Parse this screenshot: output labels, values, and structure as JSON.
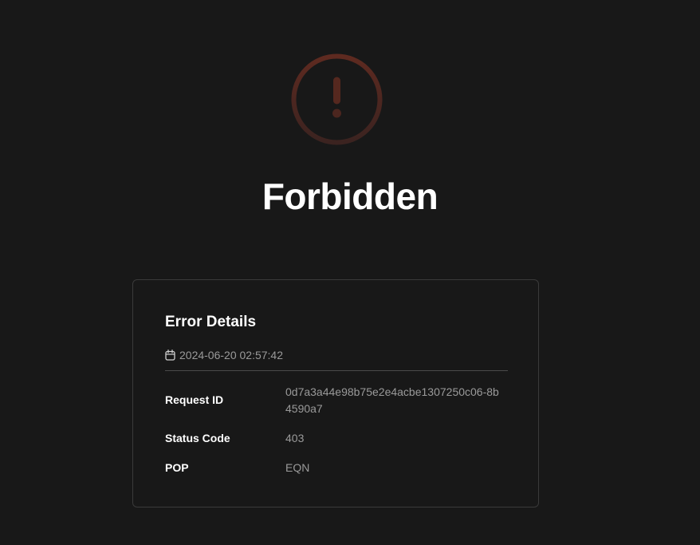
{
  "header": {
    "icon": "alert-circle-icon",
    "icon_gradient": [
      "#5a2a22",
      "#3a1f1c"
    ],
    "title": "Forbidden"
  },
  "error_details": {
    "heading": "Error Details",
    "timestamp_icon": "calendar-icon",
    "timestamp": "2024-06-20 02:57:42",
    "rows": [
      {
        "label": "Request ID",
        "value": "0d7a3a44e98b75e2e4acbe1307250c06-8b4590a7"
      },
      {
        "label": "Status Code",
        "value": "403"
      },
      {
        "label": "POP",
        "value": "EQN"
      }
    ]
  },
  "colors": {
    "background": "#181818",
    "card_border": "#3a3a3a",
    "text_primary": "#ffffff",
    "text_secondary": "#9a9a9a"
  }
}
